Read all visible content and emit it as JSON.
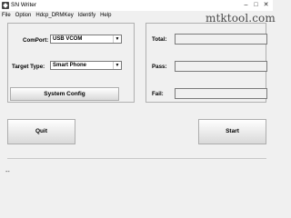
{
  "window": {
    "title": "SN Writer"
  },
  "menu": {
    "items": [
      "File",
      "Option",
      "Hdcp_DRMKey",
      "Identify",
      "Help"
    ]
  },
  "watermark": "mtktool.com",
  "left": {
    "comport_label": "ComPort:",
    "comport_value": "USB VCOM",
    "target_label": "Target Type:",
    "target_value": "Smart Phone",
    "sysconfig_label": "System Config"
  },
  "right": {
    "total_label": "Total:",
    "pass_label": "Pass:",
    "fail_label": "Fail:"
  },
  "quit_label": "Quit",
  "start_label": "Start",
  "status_text": "--"
}
